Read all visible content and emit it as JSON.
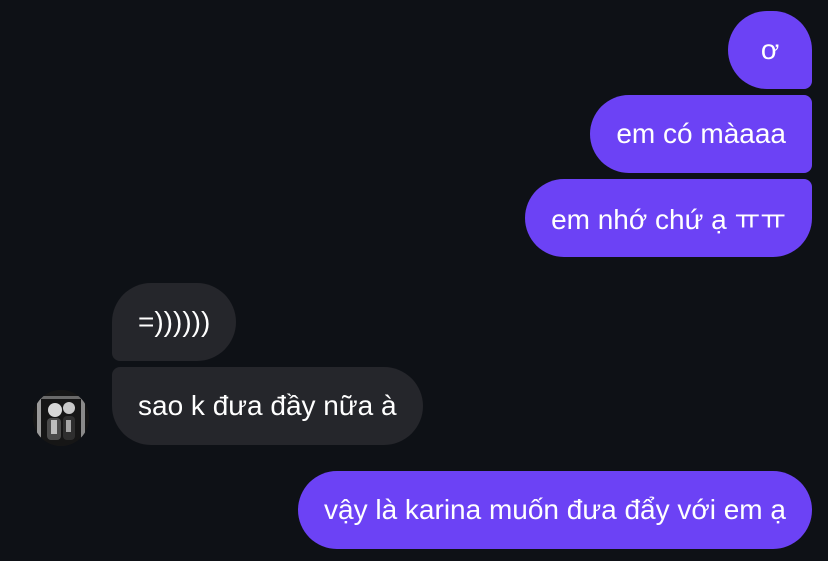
{
  "conversation": {
    "messages": [
      {
        "sender": "me",
        "text": "ơ"
      },
      {
        "sender": "me",
        "text": "em có màaaa"
      },
      {
        "sender": "me",
        "text": "em nhớ chứ ạ ㅠㅠ"
      },
      {
        "sender": "them",
        "text": "=))))))"
      },
      {
        "sender": "them",
        "text": "sao k đưa đầy nữa à"
      },
      {
        "sender": "me",
        "text": "vậy là karina muốn đưa đẩy với em ạ"
      }
    ]
  },
  "contact": {
    "avatar_icon": "contact-avatar"
  },
  "colors": {
    "background": "#0e1116",
    "outgoing_bubble": "#6c42f5",
    "incoming_bubble": "#25262b",
    "text": "#ffffff"
  }
}
